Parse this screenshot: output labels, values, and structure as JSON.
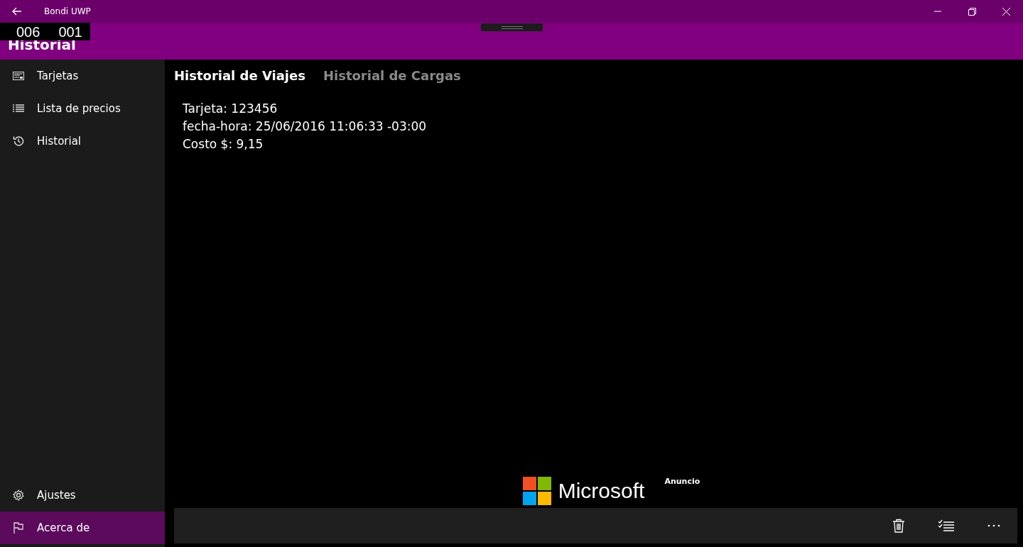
{
  "window": {
    "title": "Bondi UWP"
  },
  "counter": [
    "006",
    "001"
  ],
  "header": {
    "title": "Historial"
  },
  "sidebar": {
    "items": [
      {
        "label": "Tarjetas",
        "kind": "card",
        "selected": false
      },
      {
        "label": "Lista de precios",
        "kind": "list",
        "selected": false
      },
      {
        "label": "Historial",
        "kind": "history",
        "selected": false
      }
    ],
    "footer_items": [
      {
        "label": "Ajustes",
        "kind": "gear",
        "selected": false
      },
      {
        "label": "Acerca de",
        "kind": "flag",
        "selected": true
      }
    ]
  },
  "tabs": [
    {
      "label": "Historial de Viajes",
      "selected": true
    },
    {
      "label": "Historial de Cargas",
      "selected": false
    }
  ],
  "trip": {
    "lines": [
      "Tarjeta: 123456",
      "fecha-hora: 25/06/2016 11:06:33 -03:00",
      "Costo $: 9,15"
    ]
  },
  "ad": {
    "brand": "Microsoft",
    "label": "Anuncio"
  },
  "command_bar": {
    "buttons": [
      {
        "kind": "delete"
      },
      {
        "kind": "select"
      },
      {
        "kind": "more"
      }
    ]
  }
}
